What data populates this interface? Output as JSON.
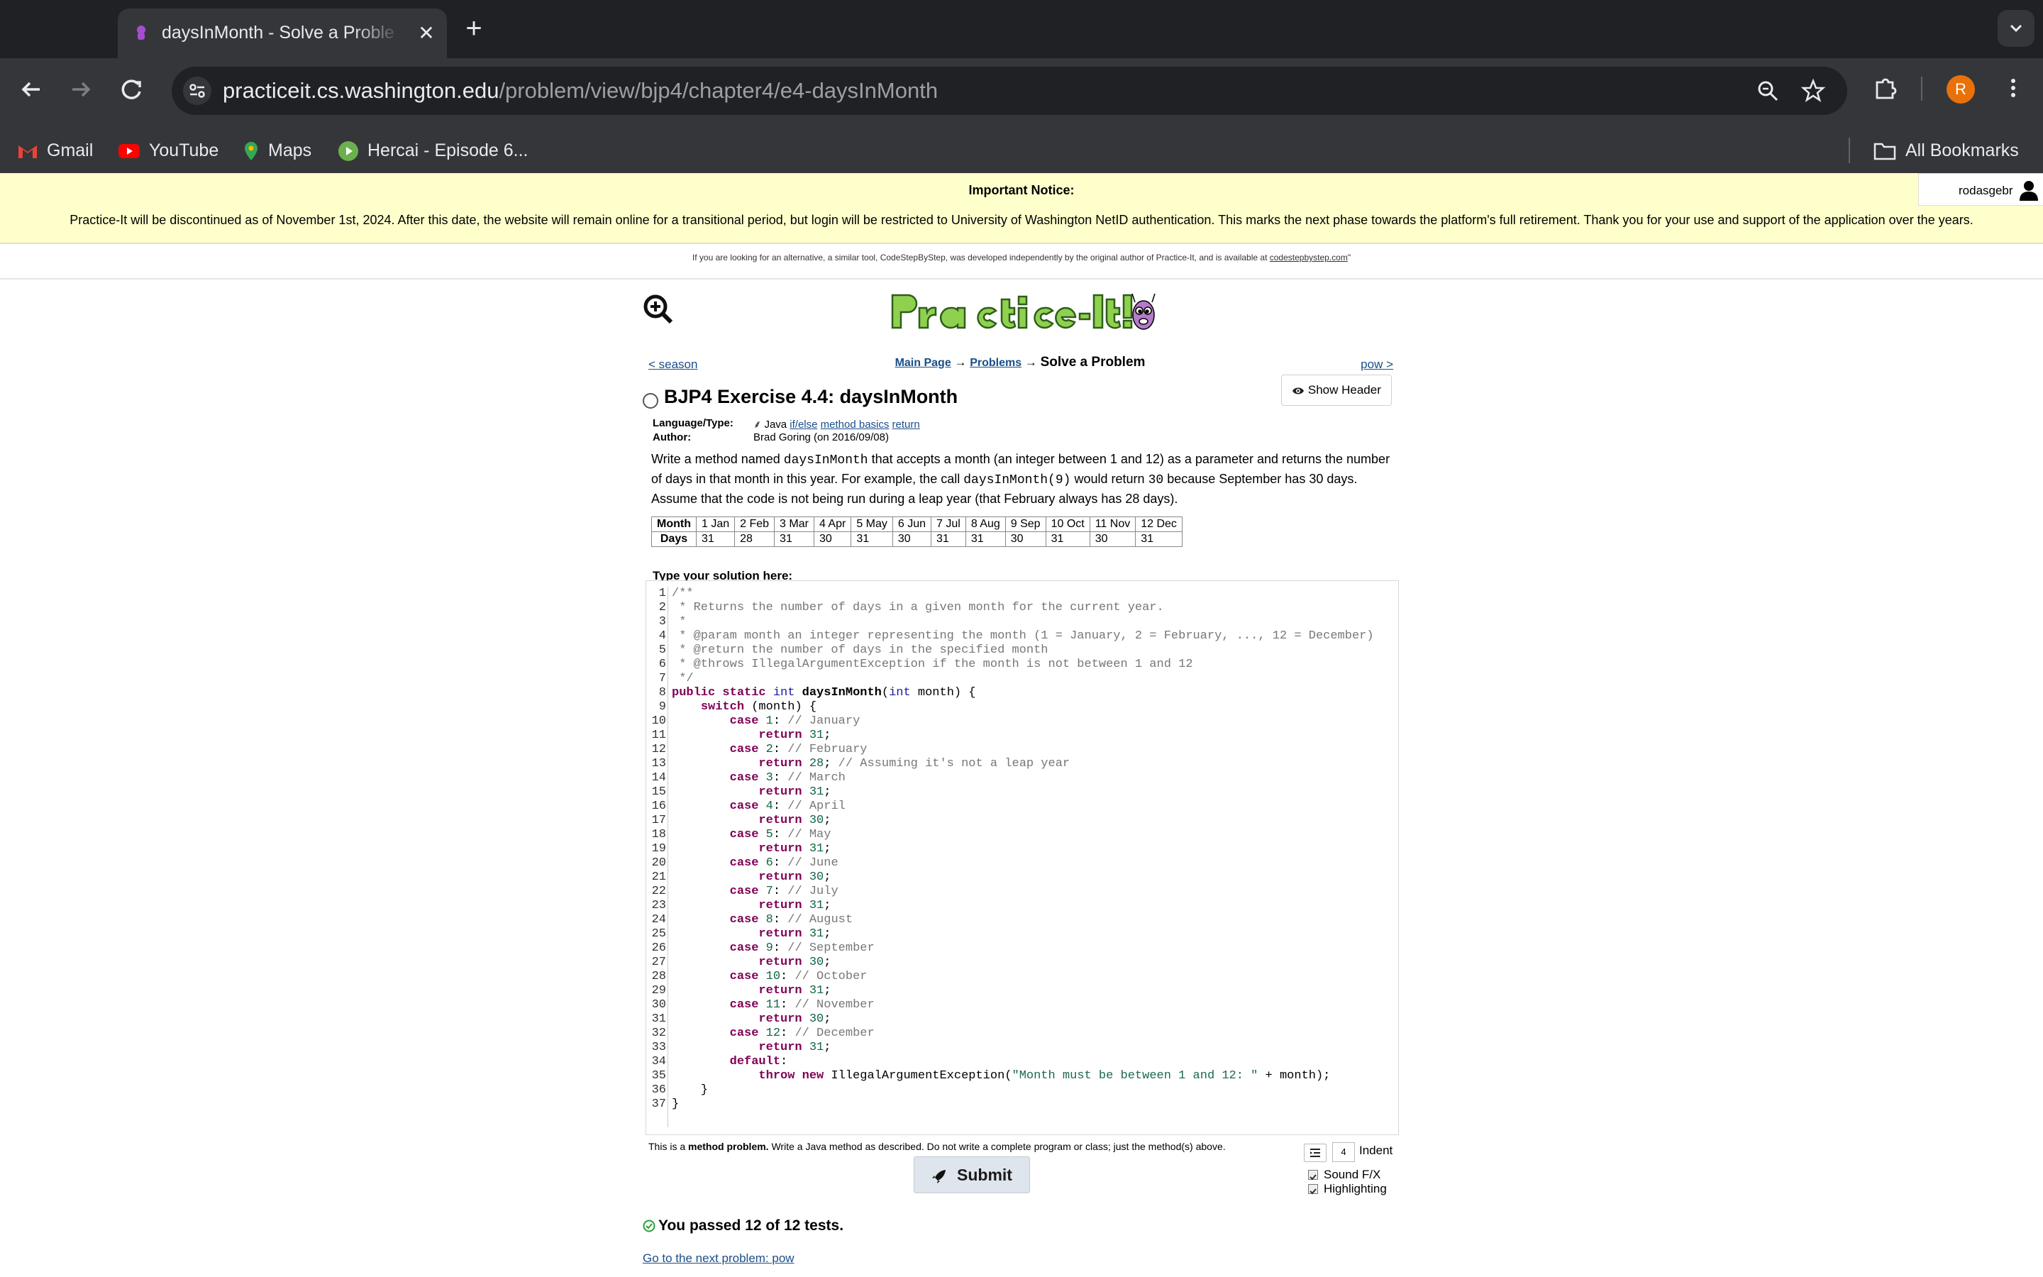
{
  "browser": {
    "tab_title": "daysInMonth - Solve a Proble",
    "url_host": "practiceit.cs.washington.edu",
    "url_path": "/problem/view/bjp4/chapter4/e4-daysInMonth",
    "profile_initial": "R",
    "bookmarks": [
      {
        "label": "Gmail",
        "icon": "gmail-icon"
      },
      {
        "label": "YouTube",
        "icon": "youtube-icon"
      },
      {
        "label": "Maps",
        "icon": "maps-icon"
      },
      {
        "label": "Hercai - Episode 6...",
        "icon": "play-icon"
      }
    ],
    "all_bookmarks": "All Bookmarks"
  },
  "notice": {
    "title": "Important Notice:",
    "text": "Practice-It will be discontinued as of November 1st, 2024. After this date, the website will remain online for a transitional period, but login will be restricted to University of Washington NetID authentication. This marks the next phase towards the platform's full retirement. Thank you for your use and support of the application over the years.",
    "username": "rodasgebr"
  },
  "alternative": {
    "text": "If you are looking for an alternative, a similar tool, CodeStepByStep, was developed independently by the original author of Practice-It, and is available at",
    "link": "codestepbystep.com",
    "suffix": "\""
  },
  "nav": {
    "prev": "< season",
    "next": "pow >",
    "crumb_main": "Main Page",
    "crumb_problems": "Problems",
    "crumb_current": "Solve a Problem",
    "arrow": "→"
  },
  "problem": {
    "title": "BJP4 Exercise 4.4: daysInMonth",
    "show_header": "Show Header",
    "language_label": "Language/Type:",
    "language": "Java",
    "tags": [
      "if/else",
      "method basics",
      "return"
    ],
    "author_label": "Author:",
    "author": "Brad Goring (on 2016/09/08)",
    "desc_1": "Write a method named",
    "desc_code1": "daysInMonth",
    "desc_2": "that accepts a month (an integer between 1 and 12) as a parameter and returns the number of days in that month in this year. For example, the call",
    "desc_code2": "daysInMonth(9)",
    "desc_3": "would return",
    "desc_code3": "30",
    "desc_4": "because September has 30 days. Assume that the code is not being run during a leap year (that February always has 28 days)."
  },
  "month_table": {
    "row_month_label": "Month",
    "row_days_label": "Days",
    "months": [
      "1 Jan",
      "2 Feb",
      "3 Mar",
      "4 Apr",
      "5 May",
      "6 Jun",
      "7 Jul",
      "8 Aug",
      "9 Sep",
      "10 Oct",
      "11 Nov",
      "12 Dec"
    ],
    "days": [
      "31",
      "28",
      "31",
      "30",
      "31",
      "30",
      "31",
      "31",
      "30",
      "31",
      "30",
      "31"
    ]
  },
  "editor": {
    "label": "Type your solution here:",
    "line_count": 37
  },
  "footer": {
    "method_note_1": "This is a",
    "method_note_bold": "method problem.",
    "method_note_2": "Write a Java method as described. Do not write a complete program or class; just the method(s) above.",
    "submit": "Submit",
    "indent_value": "4",
    "indent_label": "Indent",
    "sound": "Sound F/X",
    "highlighting": "Highlighting",
    "passed": "You passed 12 of 12 tests.",
    "next_link": "Go to the next problem: pow"
  }
}
